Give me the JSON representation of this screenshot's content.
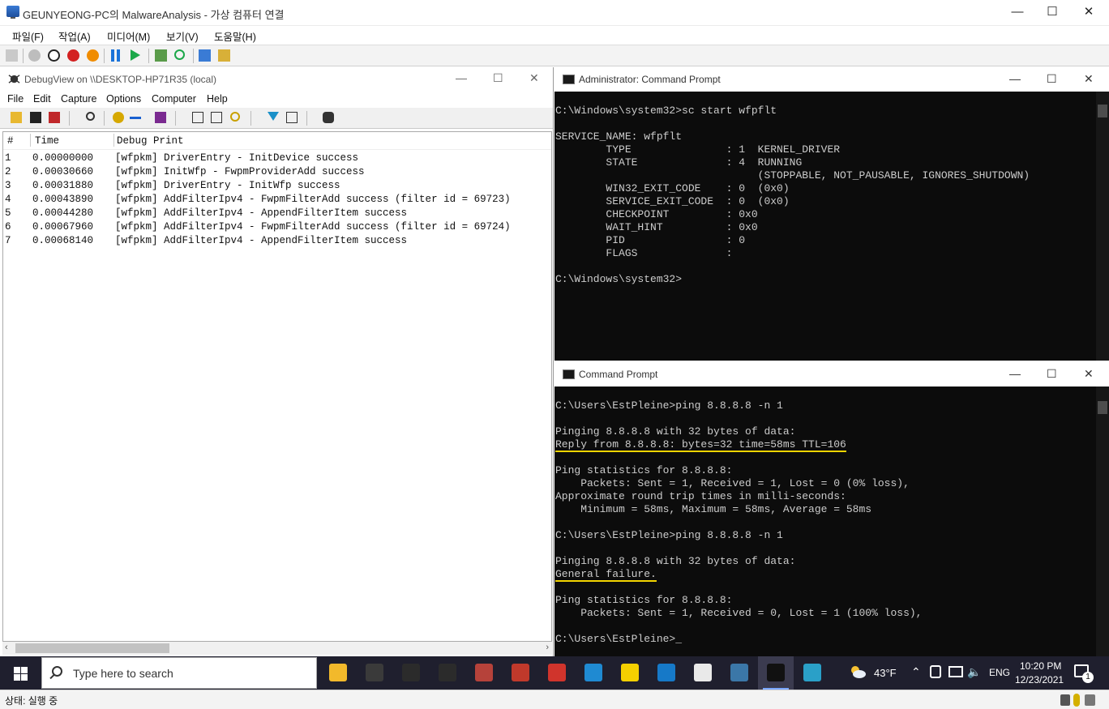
{
  "host": {
    "title": "GEUNYEONG-PC의 MalwareAnalysis - 가상 컴퓨터 연결",
    "controls": [
      "—",
      "☐",
      "✕"
    ],
    "menu": [
      "파일(F)",
      "작업(A)",
      "미디어(M)",
      "보기(V)",
      "도움말(H)"
    ],
    "status": "상태: 실행 중"
  },
  "debugview": {
    "title": "DebugView on \\\\DESKTOP-HP71R35 (local)",
    "menu": [
      "File",
      "Edit",
      "Capture",
      "Options",
      "Computer",
      "Help"
    ],
    "columns": [
      "#",
      "Time",
      "Debug Print"
    ],
    "rows": [
      {
        "n": "1",
        "time": "0.00000000",
        "text": "[wfpkm] DriverEntry - InitDevice success"
      },
      {
        "n": "2",
        "time": "0.00030660",
        "text": "[wfpkm] InitWfp - FwpmProviderAdd success"
      },
      {
        "n": "3",
        "time": "0.00031880",
        "text": "[wfpkm] DriverEntry - InitWfp success"
      },
      {
        "n": "4",
        "time": "0.00043890",
        "text": "[wfpkm] AddFilterIpv4 - FwpmFilterAdd success (filter id = 69723)"
      },
      {
        "n": "5",
        "time": "0.00044280",
        "text": "[wfpkm] AddFilterIpv4 - AppendFilterItem success"
      },
      {
        "n": "6",
        "time": "0.00067960",
        "text": "[wfpkm] AddFilterIpv4 - FwpmFilterAdd success (filter id = 69724)"
      },
      {
        "n": "7",
        "time": "0.00068140",
        "text": "[wfpkm] AddFilterIpv4 - AppendFilterItem success"
      }
    ]
  },
  "admin_cmd": {
    "title": "Administrator: Command Prompt",
    "lines": [
      "",
      "C:\\Windows\\system32>sc start wfpflt",
      "",
      "SERVICE_NAME: wfpflt",
      "        TYPE               : 1  KERNEL_DRIVER",
      "        STATE              : 4  RUNNING",
      "                                (STOPPABLE, NOT_PAUSABLE, IGNORES_SHUTDOWN)",
      "        WIN32_EXIT_CODE    : 0  (0x0)",
      "        SERVICE_EXIT_CODE  : 0  (0x0)",
      "        CHECKPOINT         : 0x0",
      "        WAIT_HINT          : 0x0",
      "        PID                : 0",
      "        FLAGS              :",
      "",
      "C:\\Windows\\system32>"
    ]
  },
  "user_cmd": {
    "title": "Command Prompt",
    "lines": [
      "",
      "C:\\Users\\EstPleine>ping 8.8.8.8 -n 1",
      "",
      "Pinging 8.8.8.8 with 32 bytes of data:",
      "Reply from 8.8.8.8: bytes=32 time=58ms TTL=106",
      "",
      "Ping statistics for 8.8.8.8:",
      "    Packets: Sent = 1, Received = 1, Lost = 0 (0% loss),",
      "Approximate round trip times in milli-seconds:",
      "    Minimum = 58ms, Maximum = 58ms, Average = 58ms",
      "",
      "C:\\Users\\EstPleine>ping 8.8.8.8 -n 1",
      "",
      "Pinging 8.8.8.8 with 32 bytes of data:",
      "General failure.",
      "",
      "Ping statistics for 8.8.8.8:",
      "    Packets: Sent = 1, Received = 0, Lost = 1 (100% loss),",
      "",
      "C:\\Users\\EstPleine>_"
    ],
    "highlighted_lines": [
      4,
      14
    ]
  },
  "taskbar": {
    "search_placeholder": "Type here to search",
    "weather": "43°F",
    "language": "ENG",
    "time": "10:20 PM",
    "date": "12/23/2021",
    "notification_count": "1",
    "apps": [
      {
        "name": "file-explorer-icon",
        "color": "#f2b92b"
      },
      {
        "name": "terminal-icon",
        "color": "#3a3a3a"
      },
      {
        "name": "bug-app-icon",
        "color": "#2b2b2b"
      },
      {
        "name": "bug-app-2-icon",
        "color": "#2b2b2b"
      },
      {
        "name": "avatar-app-icon",
        "color": "#b6423a"
      },
      {
        "name": "avatar-app-2-icon",
        "color": "#c0392b"
      },
      {
        "name": "chili-icon",
        "color": "#d0342c"
      },
      {
        "name": "vscode-icon",
        "color": "#1f8ad2"
      },
      {
        "name": "typora-icon",
        "color": "#f5d000"
      },
      {
        "name": "wireshark-icon",
        "color": "#1679c8"
      },
      {
        "name": "excel-like-icon",
        "color": "#e9e9e9"
      },
      {
        "name": "python-icon",
        "color": "#3b77a8"
      },
      {
        "name": "cmd-icon",
        "color": "#111111"
      },
      {
        "name": "debugview-icon",
        "color": "#2aa0c8"
      }
    ]
  }
}
